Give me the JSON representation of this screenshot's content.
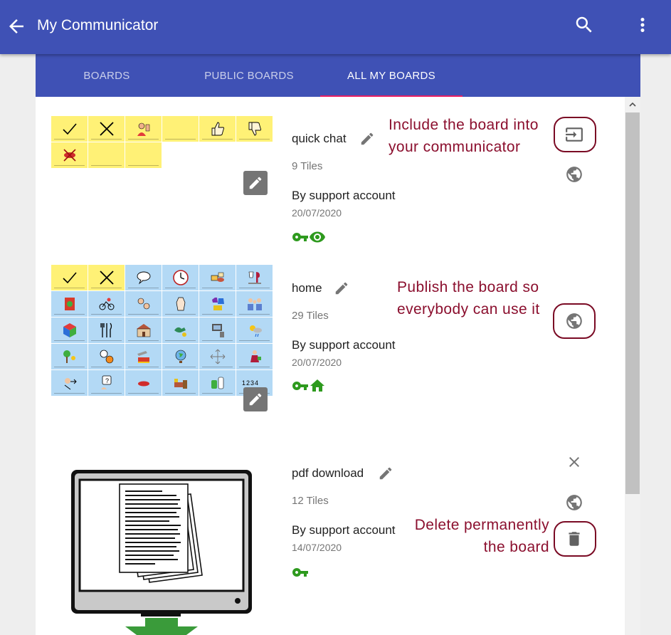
{
  "appbar": {
    "title": "My Communicator",
    "back_icon": "arrow-back-icon",
    "search_icon": "search-icon",
    "menu_icon": "more-vert-icon"
  },
  "tabs": [
    {
      "label": "BOARDS"
    },
    {
      "label": "PUBLIC BOARDS"
    },
    {
      "label": "ALL MY BOARDS",
      "active": true
    }
  ],
  "colors": {
    "primary": "#3f51b5",
    "tab_indicator": "#e91e63",
    "badge_green": "#2e9a1e",
    "annotation": "#8b0f2e"
  },
  "boards": [
    {
      "name": "quick chat",
      "tiles": "9 Tiles",
      "author": "By support account",
      "date": "20/07/2020",
      "badges": [
        "key-icon",
        "eye-icon"
      ],
      "actions": [
        "add-to-communicator-icon",
        "public-globe-icon"
      ]
    },
    {
      "name": "home",
      "tiles": "29 Tiles",
      "author": "By support account",
      "date": "20/07/2020",
      "badges": [
        "key-icon",
        "home-icon"
      ],
      "actions": [
        "public-globe-icon"
      ]
    },
    {
      "name": "pdf download",
      "tiles": "12 Tiles",
      "author": "By support account",
      "date": "14/07/2020",
      "badges": [
        "key-icon"
      ],
      "actions": [
        "close-icon",
        "public-globe-icon",
        "delete-icon"
      ]
    }
  ],
  "annotations": {
    "include": "Include the board into your communicator",
    "include_l1": "Include the board into",
    "include_l2": "your communicator",
    "publish": "Publish the board so everybody can use it",
    "publish_l1": "Publish the board so",
    "publish_l2": "everybody can use it",
    "delete": "Delete permanently the board",
    "delete_l1": "Delete permanently",
    "delete_l2": "the board"
  }
}
